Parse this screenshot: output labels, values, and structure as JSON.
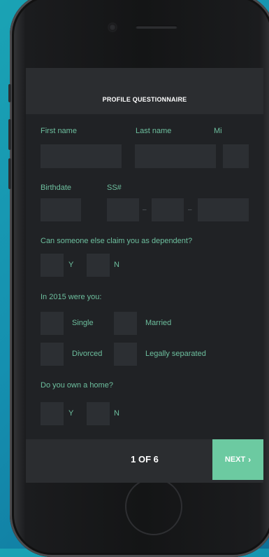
{
  "header": {
    "title": "PROFILE QUESTIONNAIRE"
  },
  "name_row": {
    "first": "First name",
    "last": "Last name",
    "mi": "Mi"
  },
  "id_row": {
    "birthdate": "Birthdate",
    "ssn": "SS#",
    "dash": "–"
  },
  "dependent": {
    "question": "Can someone else claim you as dependent?",
    "yes": "Y",
    "no": "N"
  },
  "status": {
    "question": "In 2015 were you:",
    "single": "Single",
    "married": "Married",
    "divorced": "Divorced",
    "separated": "Legally separated"
  },
  "home": {
    "question": "Do you own a home?",
    "yes": "Y",
    "no": "N"
  },
  "footer": {
    "pager": "1 OF 6",
    "next": "NEXT",
    "next_icon": "chevron-right-icon"
  },
  "colors": {
    "accent": "#6ccaa1",
    "label": "#6dbf9e",
    "screen_bg": "#202225",
    "field_bg": "#2c2f33"
  }
}
